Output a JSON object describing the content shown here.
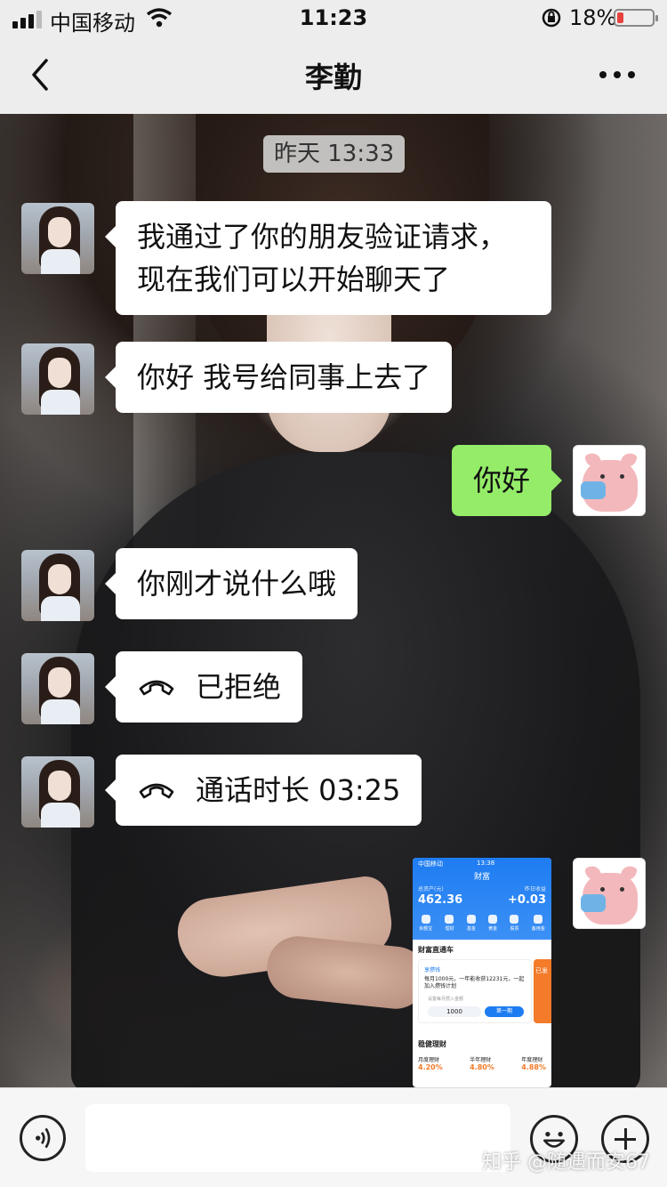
{
  "status_bar": {
    "carrier": "中国移动",
    "time": "11:23",
    "battery": "18%"
  },
  "nav": {
    "title": "李勤"
  },
  "chat": {
    "timestamp": "昨天 13:33",
    "messages": [
      {
        "side": "left",
        "text_line1": "我通过了你的朋友验证请求，",
        "text_line2": "现在我们可以开始聊天了"
      },
      {
        "side": "left",
        "text": "你好 我号给同事上去了"
      },
      {
        "side": "right",
        "text": "你好"
      },
      {
        "side": "left",
        "text": "你刚才说什么哦"
      },
      {
        "side": "left",
        "type": "call",
        "text": "已拒绝"
      },
      {
        "side": "left",
        "type": "call",
        "text": "通话时长 03:25"
      },
      {
        "side": "right",
        "type": "image"
      }
    ],
    "thumbnail": {
      "status_carrier": "中国移动",
      "status_time": "13:38",
      "title": "财富",
      "asset_label": "总资产(元)",
      "asset_value": "462.36",
      "yesterday_label": "昨日收益",
      "yesterday_value": "+0.03",
      "icons": [
        "余额宝",
        "理财",
        "基金",
        "黄金",
        "股票",
        "备用金"
      ],
      "section1": "财富直通车",
      "card_tag": "享攒钱",
      "card_text": "每月1000元，一年能收获12231元，一起加入攒钱计划",
      "card_hint": "设置每月攒入金额",
      "card_amount": "1000",
      "card_button": "第一期",
      "orange_text": "已发",
      "section2": "稳健理财",
      "rates": [
        {
          "label": "月度理财",
          "value": "4.20%"
        },
        {
          "label": "半年理财",
          "value": "4.80%"
        },
        {
          "label": "年度理财",
          "value": "4.88%"
        }
      ]
    }
  },
  "input_bar": {
    "placeholder": ""
  },
  "watermark": "知乎 @随遇而安67",
  "colors": {
    "sent_bubble": "#95ec69",
    "received_bubble": "#ffffff",
    "bar_bg": "#ededed"
  }
}
